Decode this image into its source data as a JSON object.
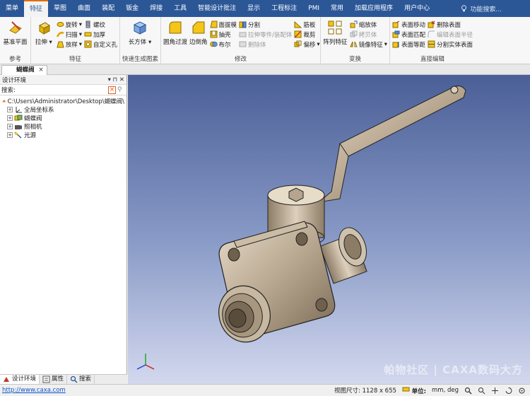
{
  "menubar": {
    "items": [
      "菜单",
      "特征",
      "草图",
      "曲面",
      "装配",
      "钣金",
      "焊接",
      "工具",
      "智能设计批注",
      "显示",
      "工程标注",
      "PMI",
      "常用",
      "加载应用程序",
      "用户中心"
    ],
    "search_placeholder": "功能搜索..."
  },
  "ribbon": {
    "ref": {
      "datum_plane": "基准平面",
      "label": "参考"
    },
    "feature": {
      "extrude": "拉伸",
      "revolve": "旋转",
      "sweep": "扫描",
      "loft": "放样",
      "thread": "螺纹",
      "thicken": "加厚",
      "custom_hole": "自定义孔",
      "label": "特征"
    },
    "quick": {
      "box": "长方体",
      "label": "快速生成图素"
    },
    "modify": {
      "fillet": "圆角过渡",
      "chamfer": "边倒角",
      "draft": "面拔模",
      "shell": "抽壳",
      "boolean": "布尔",
      "split": "分割",
      "pull_part": "拉伸零件/装配体",
      "delete_body": "删除体",
      "rib": "筋板",
      "cutout": "裁剪",
      "offset": "偏移",
      "label": "修改"
    },
    "transform": {
      "array": "阵列特征",
      "scale": "缩放体",
      "copy": "拷贝体",
      "mirror": "镜像特征",
      "label": "变换"
    },
    "direct": {
      "face_move": "表面移动",
      "face_match": "表面匹配",
      "face_equal": "表面等距",
      "delete_face": "删除表面",
      "edit_radius": "编辑表面半径",
      "split_solid": "分割实体表面",
      "label": "直接编辑"
    }
  },
  "document": {
    "tab_label": "蝴蝶阀",
    "close": "×"
  },
  "panel": {
    "title": "设计环境",
    "pin": "▾ ⊓ ✕",
    "search_label": "搜索:",
    "tree": {
      "root": "C:\\Users\\Administrator\\Desktop\\蝴蝶阀\\",
      "items": [
        "全局坐标系",
        "蝴蝶阀",
        "照相机",
        "光源"
      ]
    },
    "tabs": [
      "设计环境",
      "属性",
      "搜索"
    ]
  },
  "viewport": {
    "watermark": "帕物社区 | CAXA数码大方"
  },
  "statusbar": {
    "url": "http://www.caxa.com",
    "view_size_label": "视图尺寸: 1128 x 655",
    "units_label": "单位:",
    "units_value": "mm, deg"
  },
  "colors": {
    "menubar": "#2b5797",
    "active_tab_accent": "#e46c0a",
    "model": "#b7a68f"
  }
}
